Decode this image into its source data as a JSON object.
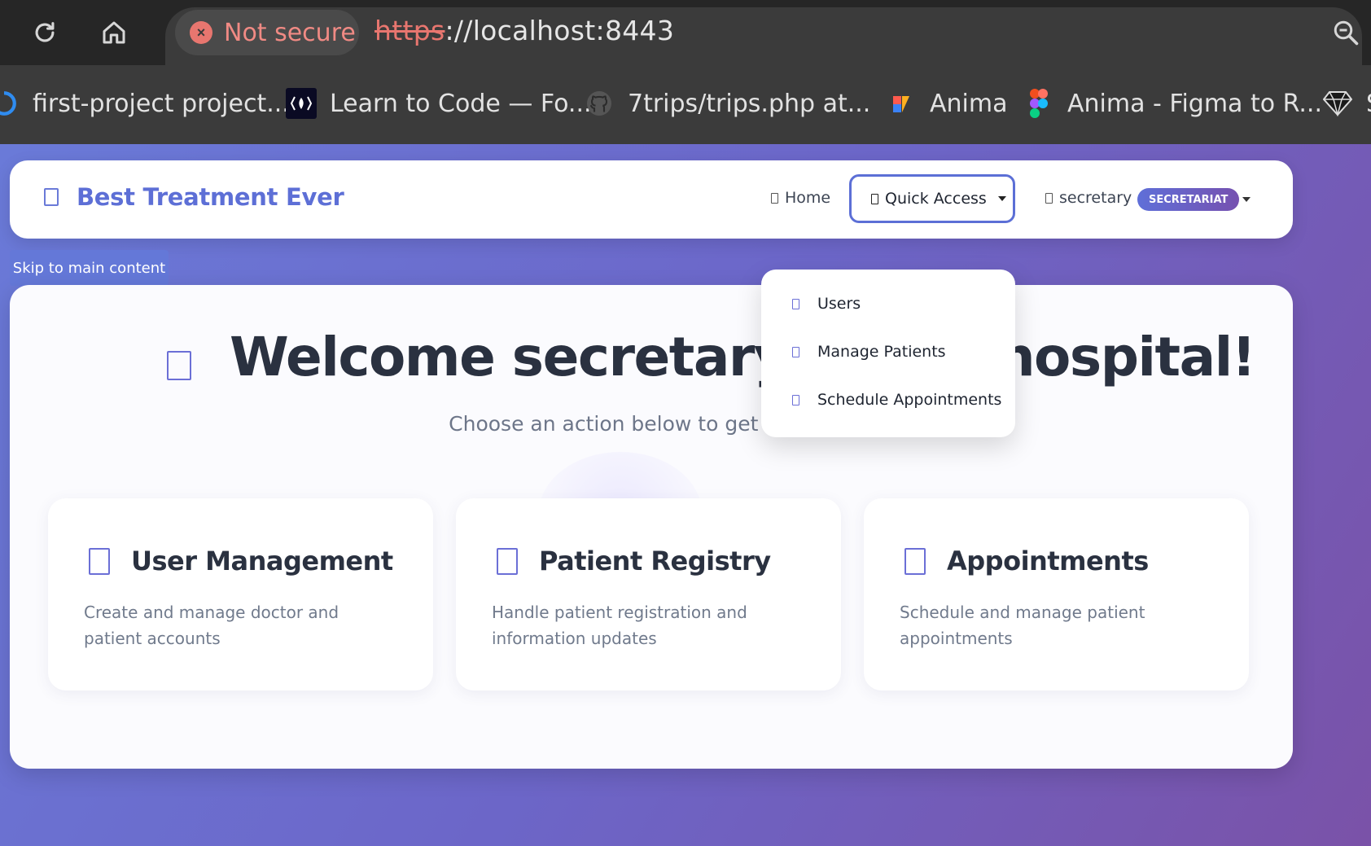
{
  "browser": {
    "security_label": "Not secure",
    "url_scheme": "https",
    "url_rest": "://localhost:8443",
    "bookmarks": [
      {
        "label": "first-project project...",
        "icon": "azure-devops-icon"
      },
      {
        "label": "Learn to Code — Fo...",
        "icon": "freecodecamp-icon"
      },
      {
        "label": "7trips/trips.php at...",
        "icon": "github-icon"
      },
      {
        "label": "Anima",
        "icon": "anima-icon"
      },
      {
        "label": "Anima - Figma to R...",
        "icon": "figma-icon"
      },
      {
        "label": "S",
        "icon": "sketch-icon"
      }
    ]
  },
  "navbar": {
    "brand": "Best Treatment Ever",
    "home": "Home",
    "quick_access": "Quick Access",
    "username": "secretary",
    "role_badge": "SECRETARIAT"
  },
  "skip_link": "Skip to main content",
  "hero": {
    "title": "Welcome secretary to the hospital!",
    "subtitle": "Choose an action below to get started"
  },
  "dropdown": {
    "items": [
      "Users",
      "Manage Patients",
      "Schedule Appointments"
    ]
  },
  "features": [
    {
      "title": "User Management",
      "desc": "Create and manage doctor and patient accounts"
    },
    {
      "title": "Patient Registry",
      "desc": "Handle patient registration and information updates"
    },
    {
      "title": "Appointments",
      "desc": "Schedule and manage patient appointments"
    }
  ],
  "colors": {
    "accent": "#5c6fd6",
    "gradient_start": "#6a7ad8",
    "gradient_end": "#7a52a8",
    "not_secure": "#e8766f"
  }
}
